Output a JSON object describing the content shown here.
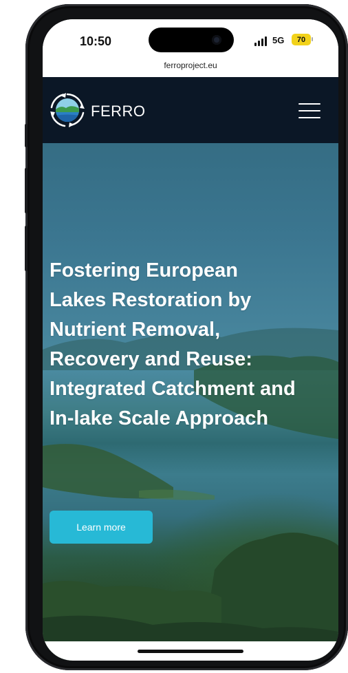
{
  "status_bar": {
    "time": "10:50",
    "network": "5G",
    "battery": "70",
    "battery_color": "#f2d21b"
  },
  "browser": {
    "url": "ferroproject.eu"
  },
  "site_header": {
    "brand": "FERRO",
    "background_color": "#0b1726",
    "menu_icon": "hamburger-menu-icon"
  },
  "hero": {
    "title": "Fostering European Lakes Restoration by Nutrient Removal, Recovery and Reuse: Integrated Catchment and In-lake Scale Approach",
    "cta_label": "Learn more",
    "cta_color": "#27b9d6"
  }
}
